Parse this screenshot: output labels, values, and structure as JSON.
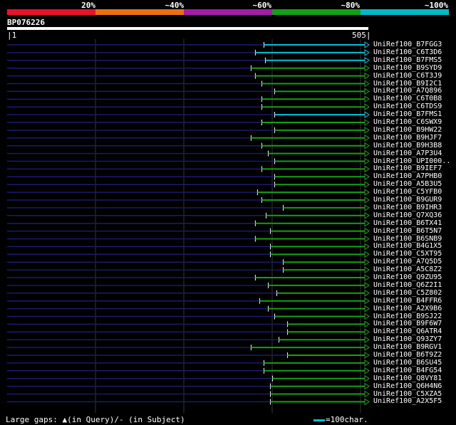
{
  "scale": {
    "labels": [
      "20%",
      "~40%",
      "~60%",
      "~80%",
      "~100%"
    ],
    "colors": [
      "#e8142c",
      "#ea7012",
      "#a11fa6",
      "#14a014",
      "#00b8c8"
    ]
  },
  "query": {
    "name": "BP076226",
    "start": "1",
    "end": "505"
  },
  "hits": [
    {
      "label": "UniRef100_B7FGG3",
      "color": "#00bfd8",
      "start_frac": 0.718
    },
    {
      "label": "UniRef100_C6T3D6",
      "color": "#00bfd8",
      "start_frac": 0.694
    },
    {
      "label": "UniRef100_B7FMS5",
      "color": "#00bfd8",
      "start_frac": 0.722
    },
    {
      "label": "UniRef100_B9SYD9",
      "color": "#14a014",
      "start_frac": 0.682
    },
    {
      "label": "UniRef100_C6T3J9",
      "color": "#14a014",
      "start_frac": 0.694
    },
    {
      "label": "UniRef100_B9I2C1",
      "color": "#14a014",
      "start_frac": 0.712
    },
    {
      "label": "UniRef100_A7Q896",
      "color": "#14a014",
      "start_frac": 0.748
    },
    {
      "label": "UniRef100_C6T0B8",
      "color": "#14a014",
      "start_frac": 0.712
    },
    {
      "label": "UniRef100_C6TDS9",
      "color": "#14a014",
      "start_frac": 0.712
    },
    {
      "label": "UniRef100_B7FMS1",
      "color": "#00bfd8",
      "start_frac": 0.748
    },
    {
      "label": "UniRef100_C6SWX9",
      "color": "#14a014",
      "start_frac": 0.712
    },
    {
      "label": "UniRef100_B9HW22",
      "color": "#14a014",
      "start_frac": 0.748
    },
    {
      "label": "UniRef100_B9HJF7",
      "color": "#14a014",
      "start_frac": 0.682
    },
    {
      "label": "UniRef100_B9H3B8",
      "color": "#14a014",
      "start_frac": 0.712
    },
    {
      "label": "UniRef100_A7P3U4",
      "color": "#14a014",
      "start_frac": 0.73
    },
    {
      "label": "UniRef100_UPI000..",
      "color": "#14a014",
      "start_frac": 0.748
    },
    {
      "label": "UniRef100_B9IEF7",
      "color": "#14a014",
      "start_frac": 0.712
    },
    {
      "label": "UniRef100_A7PHB0",
      "color": "#14a014",
      "start_frac": 0.748
    },
    {
      "label": "UniRef100_A5B3U5",
      "color": "#14a014",
      "start_frac": 0.748
    },
    {
      "label": "UniRef100_C5YFB0",
      "color": "#14a014",
      "start_frac": 0.7
    },
    {
      "label": "UniRef100_B9GUR9",
      "color": "#14a014",
      "start_frac": 0.712
    },
    {
      "label": "UniRef100_B9IHR3",
      "color": "#14a014",
      "start_frac": 0.772
    },
    {
      "label": "UniRef100_Q7XQ36",
      "color": "#14a014",
      "start_frac": 0.724
    },
    {
      "label": "UniRef100_B6TX41",
      "color": "#14a014",
      "start_frac": 0.694
    },
    {
      "label": "UniRef100_B6T5N7",
      "color": "#14a014",
      "start_frac": 0.736
    },
    {
      "label": "UniRef100_B6SNB9",
      "color": "#14a014",
      "start_frac": 0.694
    },
    {
      "label": "UniRef100_B4G1X5",
      "color": "#14a014",
      "start_frac": 0.736
    },
    {
      "label": "UniRef100_C5XT95",
      "color": "#14a014",
      "start_frac": 0.736
    },
    {
      "label": "UniRef100_A7Q5D5",
      "color": "#14a014",
      "start_frac": 0.772
    },
    {
      "label": "UniRef100_A5C8Z2",
      "color": "#14a014",
      "start_frac": 0.772
    },
    {
      "label": "UniRef100_Q9ZU95",
      "color": "#14a014",
      "start_frac": 0.694
    },
    {
      "label": "UniRef100_Q6Z2I1",
      "color": "#14a014",
      "start_frac": 0.73
    },
    {
      "label": "UniRef100_C5Z802",
      "color": "#14a014",
      "start_frac": 0.754
    },
    {
      "label": "UniRef100_B4FFR6",
      "color": "#14a014",
      "start_frac": 0.706
    },
    {
      "label": "UniRef100_A2X9B6",
      "color": "#14a014",
      "start_frac": 0.73
    },
    {
      "label": "UniRef100_B9SJ22",
      "color": "#14a014",
      "start_frac": 0.748
    },
    {
      "label": "UniRef100_B9F6W7",
      "color": "#14a014",
      "start_frac": 0.784
    },
    {
      "label": "UniRef100_Q6ATR4",
      "color": "#14a014",
      "start_frac": 0.784
    },
    {
      "label": "UniRef100_Q93ZY7",
      "color": "#14a014",
      "start_frac": 0.76
    },
    {
      "label": "UniRef100_B9RGV1",
      "color": "#14a014",
      "start_frac": 0.682
    },
    {
      "label": "UniRef100_B6T9Z2",
      "color": "#14a014",
      "start_frac": 0.784
    },
    {
      "label": "UniRef100_B6SU45",
      "color": "#14a014",
      "start_frac": 0.718
    },
    {
      "label": "UniRef100_B4FG54",
      "color": "#14a014",
      "start_frac": 0.718
    },
    {
      "label": "UniRef100_Q8VY81",
      "color": "#14a014",
      "start_frac": 0.742
    },
    {
      "label": "UniRef100_Q6H4N6",
      "color": "#14a014",
      "start_frac": 0.736
    },
    {
      "label": "UniRef100_C5XZA5",
      "color": "#14a014",
      "start_frac": 0.736
    },
    {
      "label": "UniRef100_A2X5F5",
      "color": "#14a014",
      "start_frac": 0.736
    }
  ],
  "footer": {
    "gaps_text": "Large gaps: ▲(in Query)/- (in Subject)",
    "legend_text": "=100char."
  }
}
